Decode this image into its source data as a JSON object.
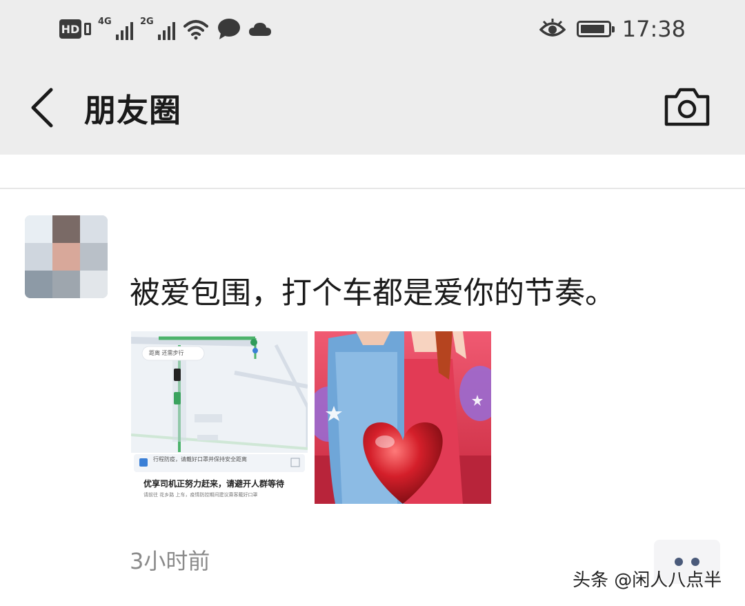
{
  "status_bar": {
    "hd_label": "HD",
    "network_1": "4G",
    "network_2": "2G",
    "time": "17:38",
    "battery_level": 0.9,
    "icons": [
      "hd-icon",
      "signal-icon",
      "wifi-icon",
      "message-icon",
      "cloud-icon",
      "eye-icon",
      "battery-icon"
    ]
  },
  "nav": {
    "back_icon": "chevron-left-icon",
    "title": "朋友圈",
    "camera_icon": "camera-icon"
  },
  "post": {
    "author_name": "",
    "text": "被爱包围，打个车都是爱你的节奏。",
    "time": "3小时前",
    "images": [
      {
        "name": "map-screenshot",
        "pill": "距离 还需步行",
        "banner": "行程防疫，请戴好口罩并保持安全距离",
        "headline": "优享司机正努力赶来，请避开人群等待",
        "body": "请前往 花乡路 上车，疫情防控期间建议乘客戴好口罩"
      },
      {
        "name": "love-heart-illustration"
      }
    ],
    "more_icon": "more-dots-icon"
  },
  "watermark": "头条 @闲人八点半",
  "colors": {
    "bar_bg": "#ededed",
    "text_primary": "#1a1a1a",
    "text_secondary": "#8a8a8a",
    "more_dots": "#4a5a7a"
  }
}
